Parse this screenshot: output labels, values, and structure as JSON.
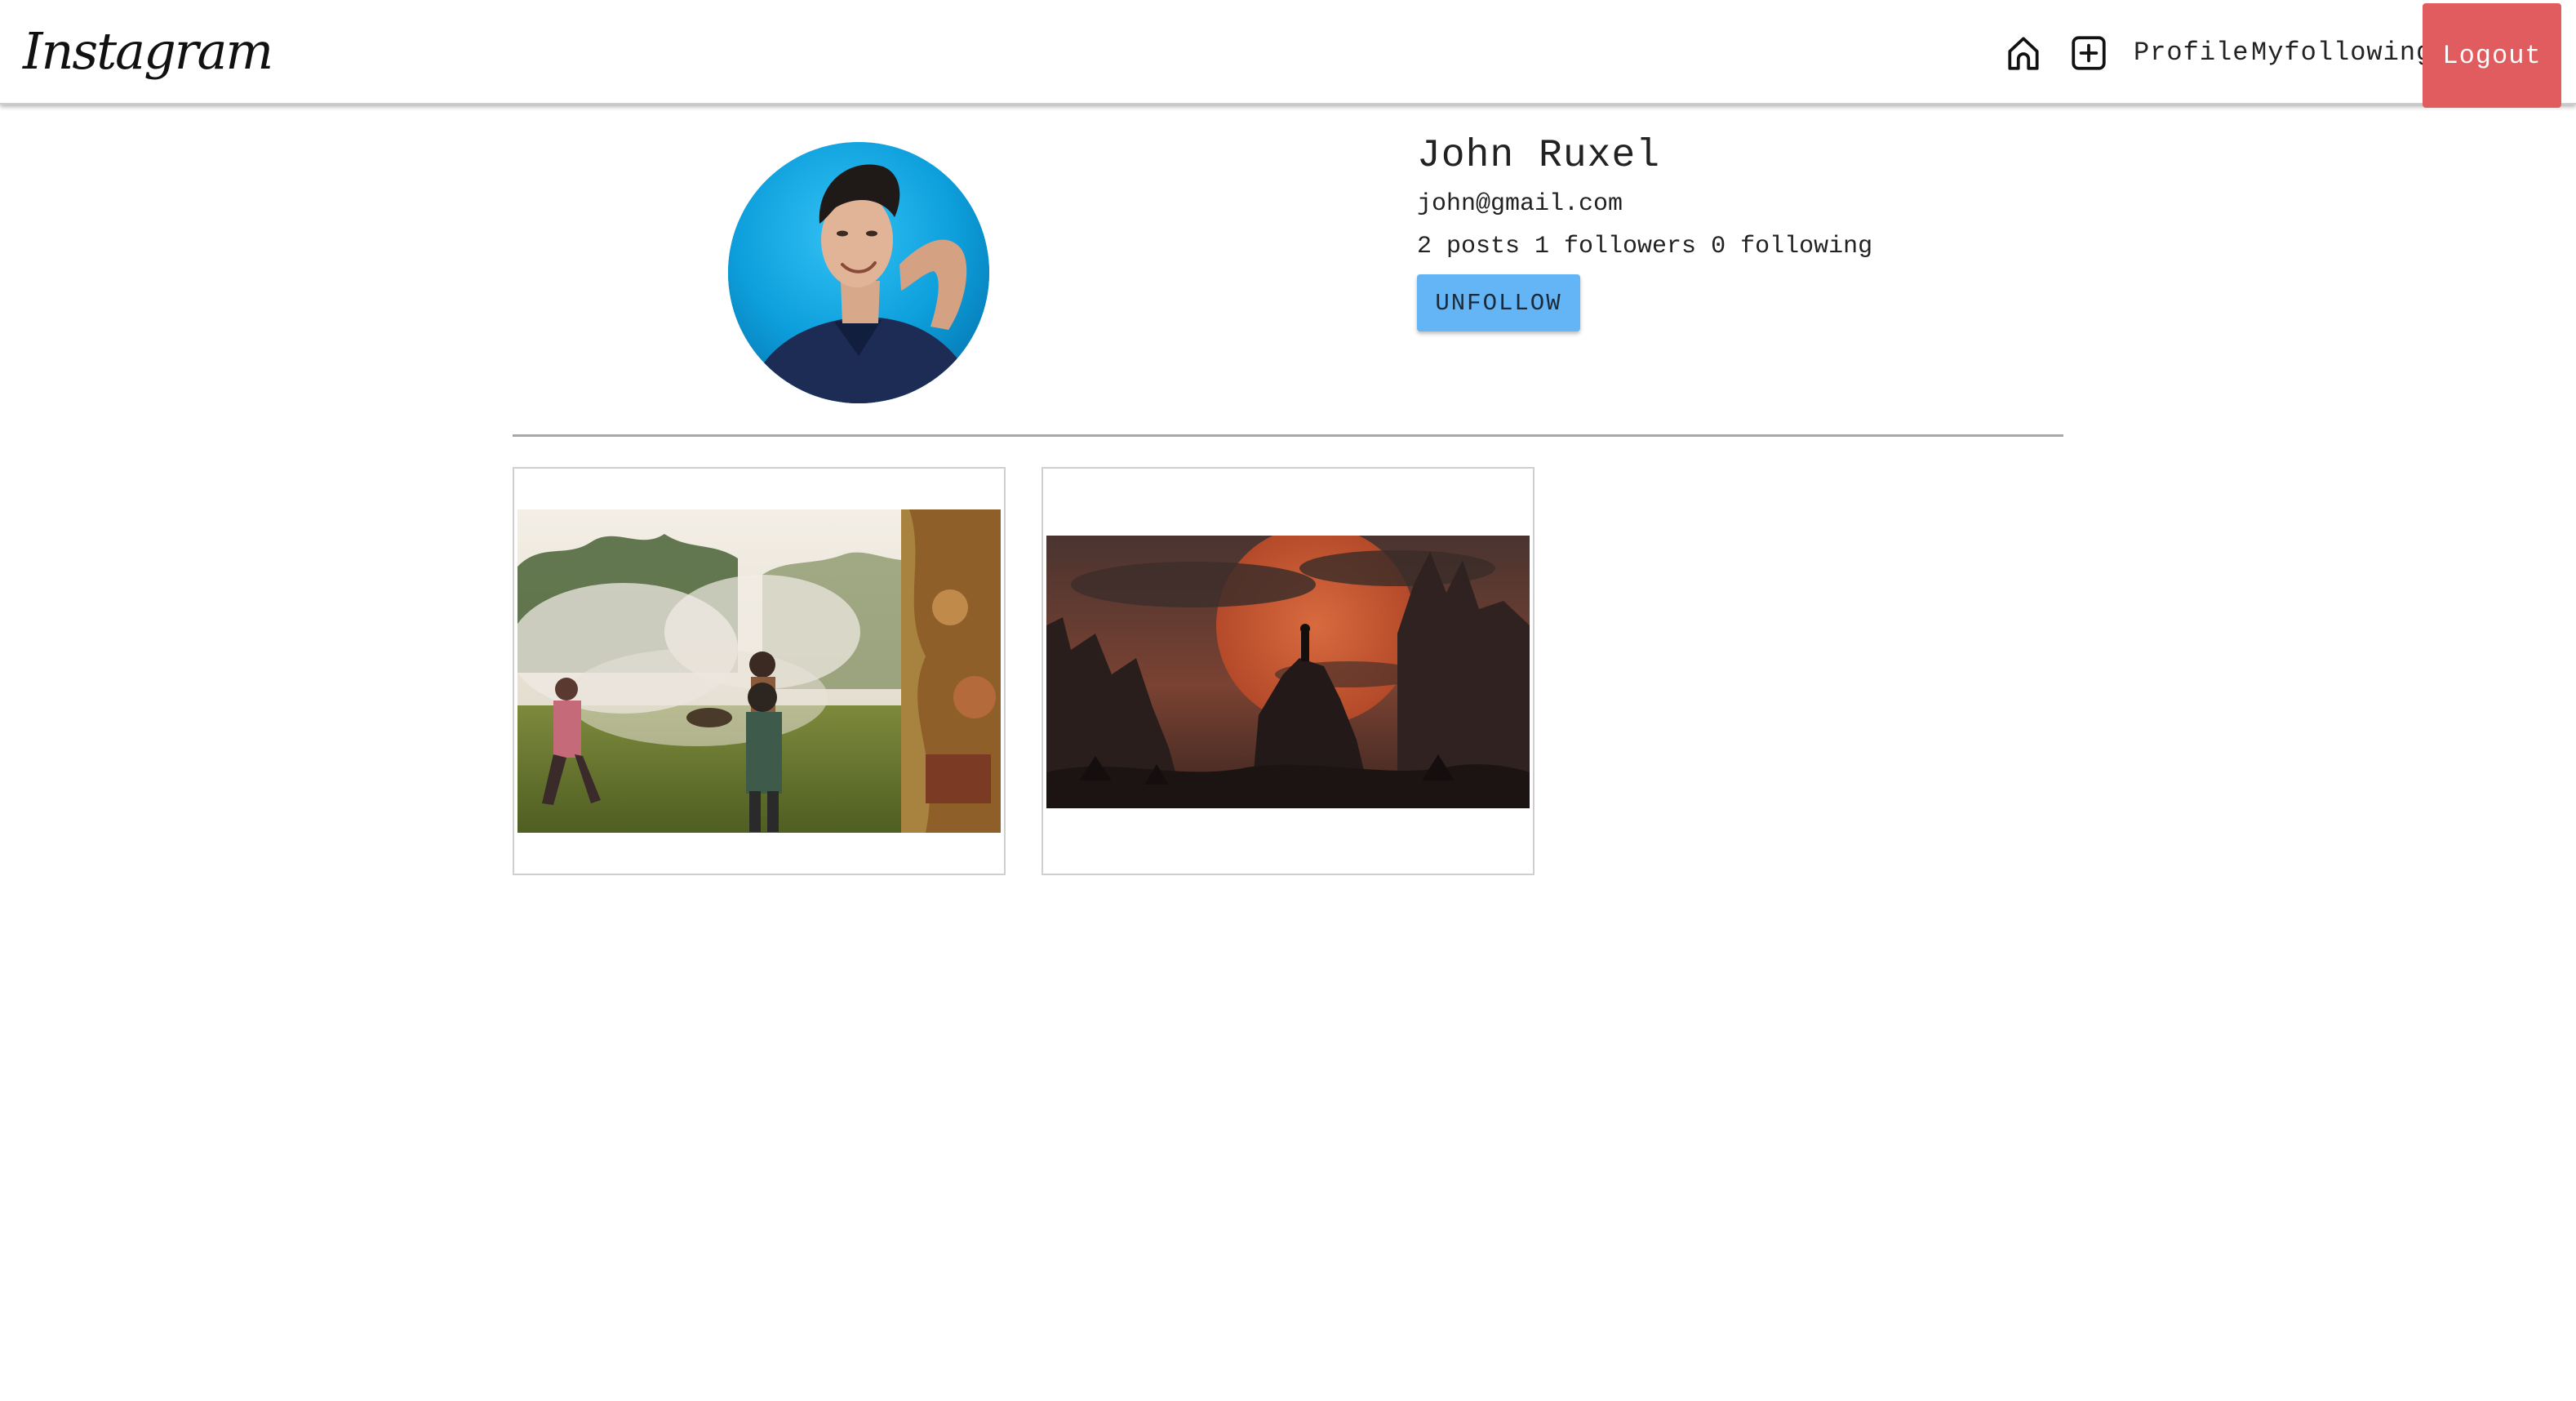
{
  "navbar": {
    "brand": "Instagram",
    "icons": {
      "home": "home-icon",
      "add": "add-post-icon"
    },
    "links": {
      "profile": "Profile",
      "myfollowing": "Myfollowing"
    },
    "logout_label": "Logout",
    "logout_color": "#e05c5f"
  },
  "profile": {
    "name": "John Ruxel",
    "email": "john@gmail.com",
    "stats": {
      "posts": "2 posts",
      "followers": "1 followers",
      "following": "0 following"
    },
    "unfollow_label": "UNFOLLOW",
    "unfollow_color": "#64b5f6"
  },
  "gallery": {
    "posts": [
      {
        "image": "festival-photo"
      },
      {
        "image": "fantasy-landscape-painting"
      }
    ]
  }
}
